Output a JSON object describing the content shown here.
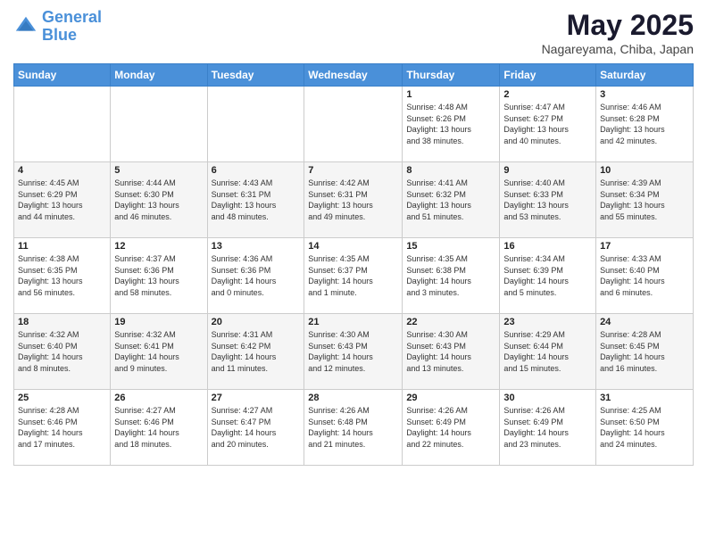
{
  "logo": {
    "line1": "General",
    "line2": "Blue"
  },
  "title": "May 2025",
  "subtitle": "Nagareyama, Chiba, Japan",
  "weekdays": [
    "Sunday",
    "Monday",
    "Tuesday",
    "Wednesday",
    "Thursday",
    "Friday",
    "Saturday"
  ],
  "weeks": [
    [
      {
        "day": "",
        "info": ""
      },
      {
        "day": "",
        "info": ""
      },
      {
        "day": "",
        "info": ""
      },
      {
        "day": "",
        "info": ""
      },
      {
        "day": "1",
        "info": "Sunrise: 4:48 AM\nSunset: 6:26 PM\nDaylight: 13 hours\nand 38 minutes."
      },
      {
        "day": "2",
        "info": "Sunrise: 4:47 AM\nSunset: 6:27 PM\nDaylight: 13 hours\nand 40 minutes."
      },
      {
        "day": "3",
        "info": "Sunrise: 4:46 AM\nSunset: 6:28 PM\nDaylight: 13 hours\nand 42 minutes."
      }
    ],
    [
      {
        "day": "4",
        "info": "Sunrise: 4:45 AM\nSunset: 6:29 PM\nDaylight: 13 hours\nand 44 minutes."
      },
      {
        "day": "5",
        "info": "Sunrise: 4:44 AM\nSunset: 6:30 PM\nDaylight: 13 hours\nand 46 minutes."
      },
      {
        "day": "6",
        "info": "Sunrise: 4:43 AM\nSunset: 6:31 PM\nDaylight: 13 hours\nand 48 minutes."
      },
      {
        "day": "7",
        "info": "Sunrise: 4:42 AM\nSunset: 6:31 PM\nDaylight: 13 hours\nand 49 minutes."
      },
      {
        "day": "8",
        "info": "Sunrise: 4:41 AM\nSunset: 6:32 PM\nDaylight: 13 hours\nand 51 minutes."
      },
      {
        "day": "9",
        "info": "Sunrise: 4:40 AM\nSunset: 6:33 PM\nDaylight: 13 hours\nand 53 minutes."
      },
      {
        "day": "10",
        "info": "Sunrise: 4:39 AM\nSunset: 6:34 PM\nDaylight: 13 hours\nand 55 minutes."
      }
    ],
    [
      {
        "day": "11",
        "info": "Sunrise: 4:38 AM\nSunset: 6:35 PM\nDaylight: 13 hours\nand 56 minutes."
      },
      {
        "day": "12",
        "info": "Sunrise: 4:37 AM\nSunset: 6:36 PM\nDaylight: 13 hours\nand 58 minutes."
      },
      {
        "day": "13",
        "info": "Sunrise: 4:36 AM\nSunset: 6:36 PM\nDaylight: 14 hours\nand 0 minutes."
      },
      {
        "day": "14",
        "info": "Sunrise: 4:35 AM\nSunset: 6:37 PM\nDaylight: 14 hours\nand 1 minute."
      },
      {
        "day": "15",
        "info": "Sunrise: 4:35 AM\nSunset: 6:38 PM\nDaylight: 14 hours\nand 3 minutes."
      },
      {
        "day": "16",
        "info": "Sunrise: 4:34 AM\nSunset: 6:39 PM\nDaylight: 14 hours\nand 5 minutes."
      },
      {
        "day": "17",
        "info": "Sunrise: 4:33 AM\nSunset: 6:40 PM\nDaylight: 14 hours\nand 6 minutes."
      }
    ],
    [
      {
        "day": "18",
        "info": "Sunrise: 4:32 AM\nSunset: 6:40 PM\nDaylight: 14 hours\nand 8 minutes."
      },
      {
        "day": "19",
        "info": "Sunrise: 4:32 AM\nSunset: 6:41 PM\nDaylight: 14 hours\nand 9 minutes."
      },
      {
        "day": "20",
        "info": "Sunrise: 4:31 AM\nSunset: 6:42 PM\nDaylight: 14 hours\nand 11 minutes."
      },
      {
        "day": "21",
        "info": "Sunrise: 4:30 AM\nSunset: 6:43 PM\nDaylight: 14 hours\nand 12 minutes."
      },
      {
        "day": "22",
        "info": "Sunrise: 4:30 AM\nSunset: 6:43 PM\nDaylight: 14 hours\nand 13 minutes."
      },
      {
        "day": "23",
        "info": "Sunrise: 4:29 AM\nSunset: 6:44 PM\nDaylight: 14 hours\nand 15 minutes."
      },
      {
        "day": "24",
        "info": "Sunrise: 4:28 AM\nSunset: 6:45 PM\nDaylight: 14 hours\nand 16 minutes."
      }
    ],
    [
      {
        "day": "25",
        "info": "Sunrise: 4:28 AM\nSunset: 6:46 PM\nDaylight: 14 hours\nand 17 minutes."
      },
      {
        "day": "26",
        "info": "Sunrise: 4:27 AM\nSunset: 6:46 PM\nDaylight: 14 hours\nand 18 minutes."
      },
      {
        "day": "27",
        "info": "Sunrise: 4:27 AM\nSunset: 6:47 PM\nDaylight: 14 hours\nand 20 minutes."
      },
      {
        "day": "28",
        "info": "Sunrise: 4:26 AM\nSunset: 6:48 PM\nDaylight: 14 hours\nand 21 minutes."
      },
      {
        "day": "29",
        "info": "Sunrise: 4:26 AM\nSunset: 6:49 PM\nDaylight: 14 hours\nand 22 minutes."
      },
      {
        "day": "30",
        "info": "Sunrise: 4:26 AM\nSunset: 6:49 PM\nDaylight: 14 hours\nand 23 minutes."
      },
      {
        "day": "31",
        "info": "Sunrise: 4:25 AM\nSunset: 6:50 PM\nDaylight: 14 hours\nand 24 minutes."
      }
    ]
  ]
}
